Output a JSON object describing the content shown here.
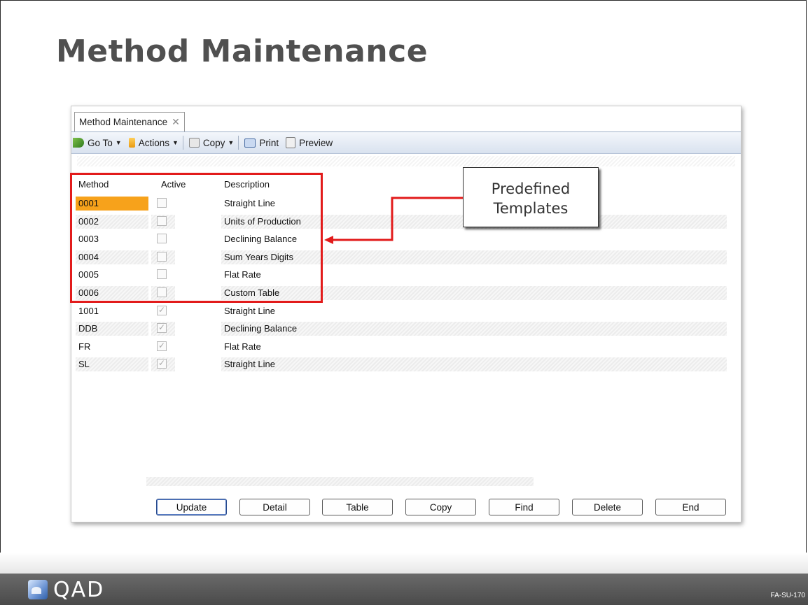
{
  "slide": {
    "title": "Method Maintenance",
    "logo_text": "QAD",
    "slide_code": "FA-SU-170"
  },
  "window": {
    "tab_label": "Method Maintenance",
    "tab_close_icon": "close-icon",
    "toolbar": {
      "goto": "Go To",
      "actions": "Actions",
      "copy": "Copy",
      "print": "Print",
      "preview": "Preview"
    }
  },
  "grid": {
    "headers": {
      "method": "Method",
      "active": "Active",
      "description": "Description"
    },
    "rows": [
      {
        "method": "0001",
        "active": false,
        "description": "Straight Line",
        "selected": true
      },
      {
        "method": "0002",
        "active": false,
        "description": "Units of Production"
      },
      {
        "method": "0003",
        "active": false,
        "description": "Declining Balance"
      },
      {
        "method": "0004",
        "active": false,
        "description": "Sum Years Digits"
      },
      {
        "method": "0005",
        "active": false,
        "description": "Flat Rate"
      },
      {
        "method": "0006",
        "active": false,
        "description": "Custom Table"
      },
      {
        "method": "1001",
        "active": true,
        "description": "Straight Line"
      },
      {
        "method": "DDB",
        "active": true,
        "description": "Declining Balance"
      },
      {
        "method": "FR",
        "active": true,
        "description": "Flat Rate"
      },
      {
        "method": "SL",
        "active": true,
        "description": "Straight Line"
      }
    ]
  },
  "callout": {
    "line1": "Predefined",
    "line2": "Templates",
    "border_color": "#e21b1b"
  },
  "buttons": {
    "update": "Update",
    "detail": "Detail",
    "table": "Table",
    "copy": "Copy",
    "find": "Find",
    "delete": "Delete",
    "end": "End"
  },
  "colors": {
    "selected_cell": "#f7a21b",
    "highlight_red": "#e21b1b",
    "footer": "#555555"
  }
}
